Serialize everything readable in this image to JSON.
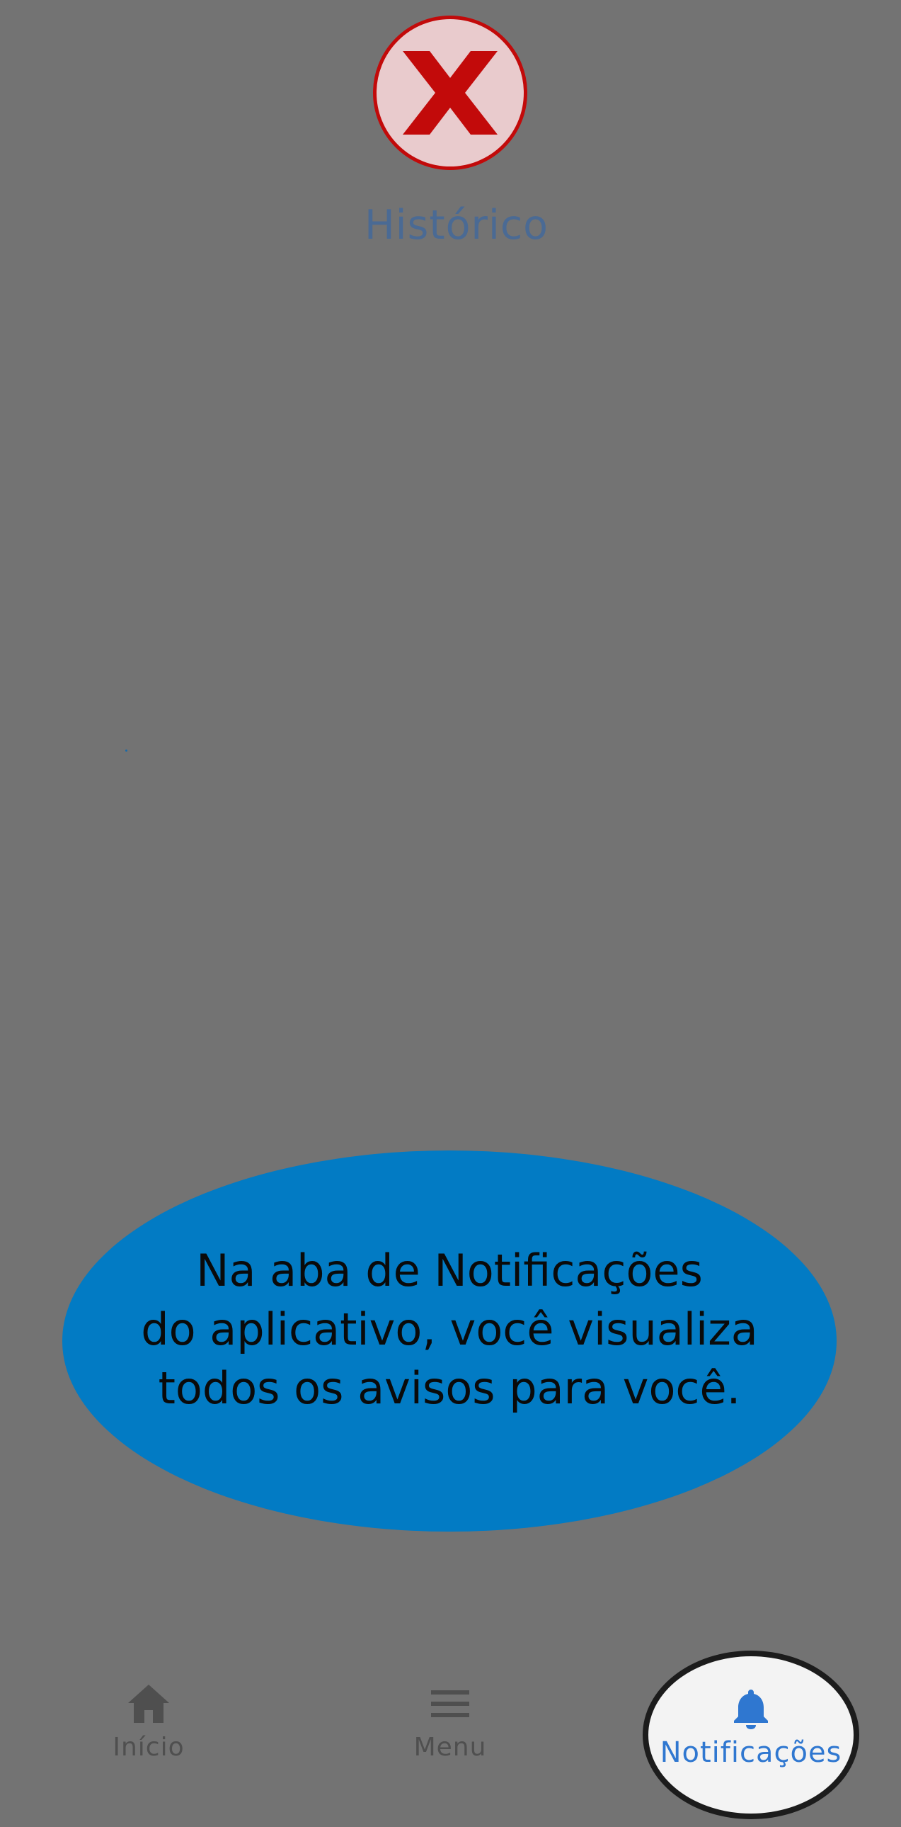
{
  "header": {
    "close_icon": "close-x-icon",
    "title": "Histórico"
  },
  "tooltip": {
    "text": "Na aba de Notificações\ndo aplicativo, você visualiza\ntodos os avisos para você."
  },
  "bottom_nav": {
    "items": [
      {
        "label": "Início",
        "icon": "home-icon"
      },
      {
        "label": "Menu",
        "icon": "hamburger-menu-icon"
      },
      {
        "label": "Notificações",
        "icon": "bell-icon"
      }
    ]
  },
  "colors": {
    "overlay": "#737373",
    "close_border": "#c20a0a",
    "close_fill": "#e9cbcd",
    "tooltip": "#027bc4",
    "active_nav": "#2f77d0"
  }
}
